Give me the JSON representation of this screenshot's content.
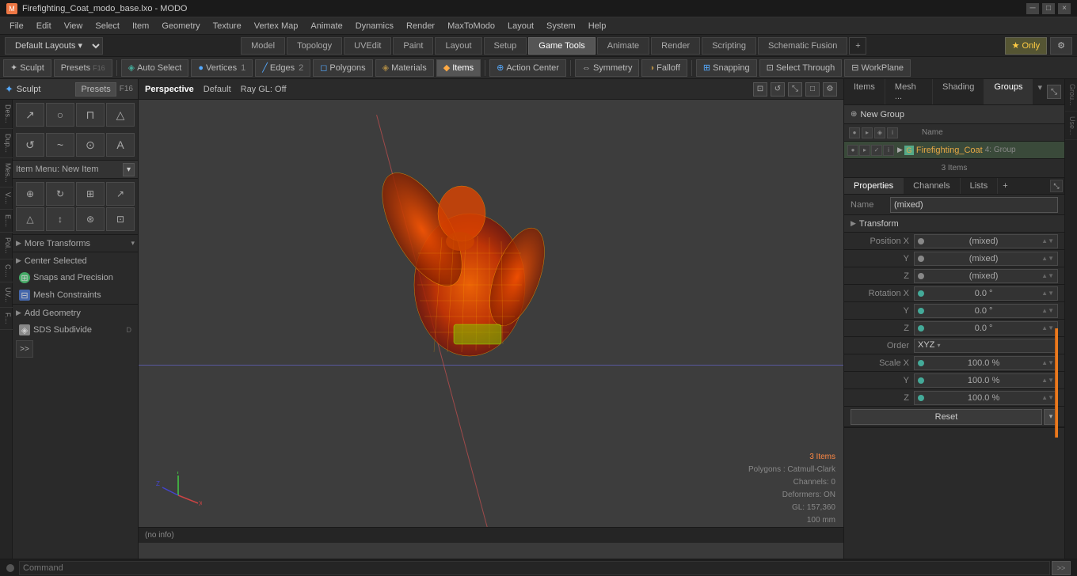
{
  "titlebar": {
    "title": "Firefighting_Coat_modo_base.lxo - MODO",
    "icon": "M",
    "controls": [
      "─",
      "□",
      "×"
    ]
  },
  "menubar": {
    "items": [
      "File",
      "Edit",
      "View",
      "Select",
      "Item",
      "Geometry",
      "Texture",
      "Vertex Map",
      "Animate",
      "Dynamics",
      "Render",
      "MaxToModo",
      "Layout",
      "System",
      "Help"
    ]
  },
  "layoutbar": {
    "dropdown_label": "Default Layouts ▾",
    "tabs": [
      "Model",
      "Topology",
      "UVEdit",
      "Paint",
      "Layout",
      "Setup",
      "Game Tools",
      "Animate",
      "Render",
      "Scripting",
      "Schematic Fusion"
    ],
    "active_tab": "Model",
    "star_label": "★ Only",
    "gear_label": "⚙"
  },
  "toolbar": {
    "sculpt_label": "Sculpt",
    "presets_label": "Presets",
    "presets_key": "F16",
    "auto_select_label": "Auto Select",
    "vertices_label": "Vertices",
    "vertices_count": "1",
    "edges_label": "Edges",
    "edges_count": "2",
    "polygons_label": "Polygons",
    "materials_label": "Materials",
    "items_label": "Items",
    "action_center_label": "Action Center",
    "symmetry_label": "Symmetry",
    "falloff_label": "Falloff",
    "snapping_label": "Snapping",
    "select_through_label": "Select Through",
    "workplane_label": "WorkPlane"
  },
  "left_panel": {
    "item_menu_label": "Item Menu: New Item",
    "more_transforms_label": "More Transforms",
    "center_selected_label": "Center Selected",
    "snaps_precision_label": "Snaps and Precision",
    "mesh_constraints_label": "Mesh Constraints",
    "add_geometry_label": "Add Geometry",
    "sds_subdivide_label": "SDS Subdivide",
    "side_tabs": [
      "Des...",
      "Dup...",
      "Mes...",
      "V....",
      "E....",
      "Pol...",
      "C....",
      "UV...",
      "F...."
    ],
    "more_label": ">>"
  },
  "viewport": {
    "perspective_label": "Perspective",
    "default_label": "Default",
    "ray_gl_label": "Ray GL: Off",
    "footer_text": "(no info)",
    "info": {
      "items": "3 Items",
      "polygons": "Polygons : Catmull-Clark",
      "channels": "Channels: 0",
      "deformers": "Deformers: ON",
      "gl": "GL: 157,360",
      "scale": "100 mm"
    }
  },
  "right_panel": {
    "top_tabs": [
      "Items",
      "Mesh ...",
      "Shading",
      "Groups"
    ],
    "active_top_tab": "Groups",
    "new_group_label": "New Group",
    "list_header": {
      "name_label": "Name"
    },
    "group_row": {
      "name": "Firefighting_Coat",
      "count": "4",
      "group_suffix": ": Group",
      "sub_count": "3 Items"
    },
    "properties": {
      "tabs": [
        "Properties",
        "Channels",
        "Lists"
      ],
      "active_tab": "Properties",
      "plus_label": "+",
      "name_label": "Name",
      "name_value": "(mixed)",
      "transform_label": "Transform",
      "position_x_label": "Position X",
      "position_x": "(mixed)",
      "position_y_label": "Y",
      "position_y": "(mixed)",
      "position_z_label": "Z",
      "position_z": "(mixed)",
      "rotation_x_label": "Rotation X",
      "rotation_x": "0.0 °",
      "rotation_y_label": "Y",
      "rotation_y": "0.0 °",
      "rotation_z_label": "Z",
      "rotation_z": "0.0 °",
      "order_label": "Order",
      "order_value": "XYZ",
      "scale_x_label": "Scale X",
      "scale_x": "100.0 %",
      "scale_y_label": "Y",
      "scale_y": "100.0 %",
      "scale_z_label": "Z",
      "scale_z": "100.0 %",
      "reset_label": "Reset"
    }
  },
  "statusbar": {
    "command_label": "Command",
    "go_label": ">>"
  }
}
